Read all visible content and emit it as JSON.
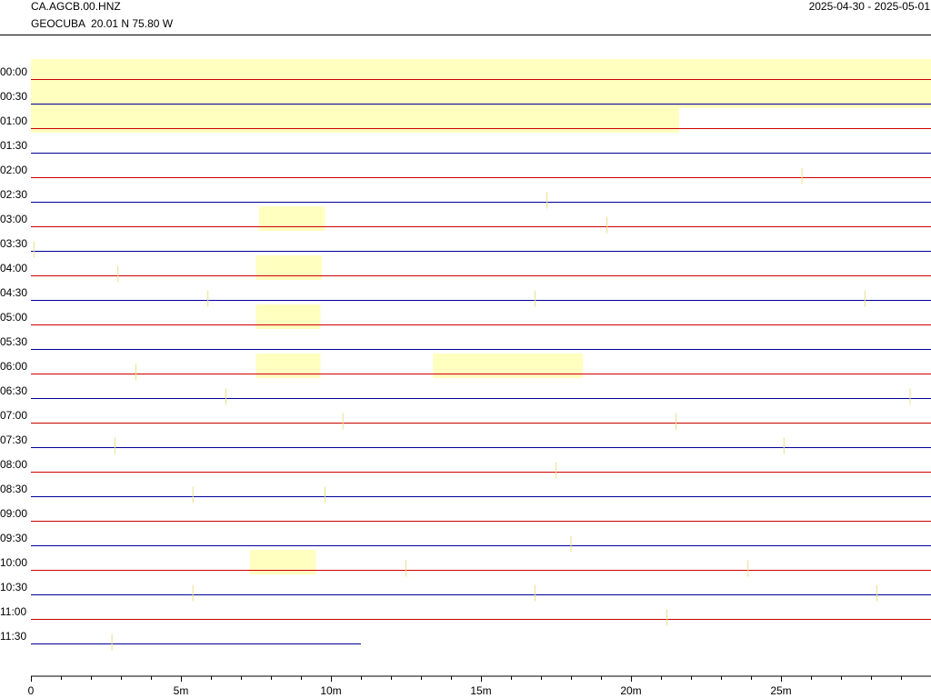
{
  "header": {
    "station_code": "CA.AGCB.00.HNZ",
    "station_info": "GEOCUBA  20.01 N 75.80 W",
    "date_range": "2025-04-30 - 2025-05-01"
  },
  "colors": {
    "even_trace": "#cc0000",
    "odd_trace": "#000099",
    "highlight": "#ffffc0",
    "spike": "#e8e08a",
    "axis": "#000000"
  },
  "chart_data": {
    "type": "helicorder",
    "minutes_per_line": 30,
    "x_unit": "minutes",
    "xlim": [
      0,
      30
    ],
    "x_ticks": [
      {
        "value": 0,
        "label": "0"
      },
      {
        "value": 5,
        "label": "5m"
      },
      {
        "value": 10,
        "label": "10m"
      },
      {
        "value": 15,
        "label": "15m"
      },
      {
        "value": 20,
        "label": "20m"
      },
      {
        "value": 25,
        "label": "25m"
      }
    ],
    "rows": [
      {
        "label": "00:00",
        "trace_end": 30
      },
      {
        "label": "00:30",
        "trace_end": 30
      },
      {
        "label": "01:00",
        "trace_end": 30
      },
      {
        "label": "01:30",
        "trace_end": 30
      },
      {
        "label": "02:00",
        "trace_end": 30
      },
      {
        "label": "02:30",
        "trace_end": 30
      },
      {
        "label": "03:00",
        "trace_end": 30
      },
      {
        "label": "03:30",
        "trace_end": 30
      },
      {
        "label": "04:00",
        "trace_end": 30
      },
      {
        "label": "04:30",
        "trace_end": 30
      },
      {
        "label": "05:00",
        "trace_end": 30
      },
      {
        "label": "05:30",
        "trace_end": 30
      },
      {
        "label": "06:00",
        "trace_end": 30
      },
      {
        "label": "06:30",
        "trace_end": 30
      },
      {
        "label": "07:00",
        "trace_end": 30
      },
      {
        "label": "07:30",
        "trace_end": 30
      },
      {
        "label": "08:00",
        "trace_end": 30
      },
      {
        "label": "08:30",
        "trace_end": 30
      },
      {
        "label": "09:00",
        "trace_end": 30
      },
      {
        "label": "09:30",
        "trace_end": 30
      },
      {
        "label": "10:00",
        "trace_end": 30
      },
      {
        "label": "10:30",
        "trace_end": 30
      },
      {
        "label": "11:00",
        "trace_end": 30
      },
      {
        "label": "11:30",
        "trace_end": 11.0
      }
    ],
    "gap_blocks": [
      {
        "row_start": 0,
        "row_end": 1,
        "start_min": 0,
        "end_min": 30
      },
      {
        "row_start": 2,
        "row_end": 2,
        "start_min": 0,
        "end_min": 21.6
      },
      {
        "row_start": 6,
        "row_end": 6,
        "start_min": 7.6,
        "end_min": 9.8
      },
      {
        "row_start": 8,
        "row_end": 8,
        "start_min": 7.5,
        "end_min": 9.7
      },
      {
        "row_start": 10,
        "row_end": 10,
        "start_min": 7.5,
        "end_min": 9.65
      },
      {
        "row_start": 12,
        "row_end": 12,
        "start_min": 7.5,
        "end_min": 9.65
      },
      {
        "row_start": 12,
        "row_end": 12,
        "start_min": 13.4,
        "end_min": 18.4
      },
      {
        "row_start": 20,
        "row_end": 20,
        "start_min": 7.3,
        "end_min": 9.5
      }
    ],
    "spikes": [
      {
        "row": 4,
        "minute": 25.7
      },
      {
        "row": 5,
        "minute": 17.2
      },
      {
        "row": 6,
        "minute": 19.2
      },
      {
        "row": 7,
        "minute": 0.1
      },
      {
        "row": 8,
        "minute": 2.9
      },
      {
        "row": 9,
        "minute": 5.9
      },
      {
        "row": 9,
        "minute": 16.8
      },
      {
        "row": 9,
        "minute": 27.8
      },
      {
        "row": 12,
        "minute": 3.5
      },
      {
        "row": 13,
        "minute": 6.5
      },
      {
        "row": 13,
        "minute": 29.3
      },
      {
        "row": 14,
        "minute": 10.4
      },
      {
        "row": 14,
        "minute": 21.5
      },
      {
        "row": 15,
        "minute": 2.8
      },
      {
        "row": 15,
        "minute": 25.1
      },
      {
        "row": 16,
        "minute": 17.5
      },
      {
        "row": 17,
        "minute": 5.4
      },
      {
        "row": 17,
        "minute": 9.8
      },
      {
        "row": 19,
        "minute": 18.0
      },
      {
        "row": 20,
        "minute": 12.5
      },
      {
        "row": 20,
        "minute": 23.9
      },
      {
        "row": 21,
        "minute": 5.4
      },
      {
        "row": 21,
        "minute": 16.8
      },
      {
        "row": 21,
        "minute": 28.2
      },
      {
        "row": 22,
        "minute": 21.2
      },
      {
        "row": 23,
        "minute": 2.7
      }
    ]
  }
}
